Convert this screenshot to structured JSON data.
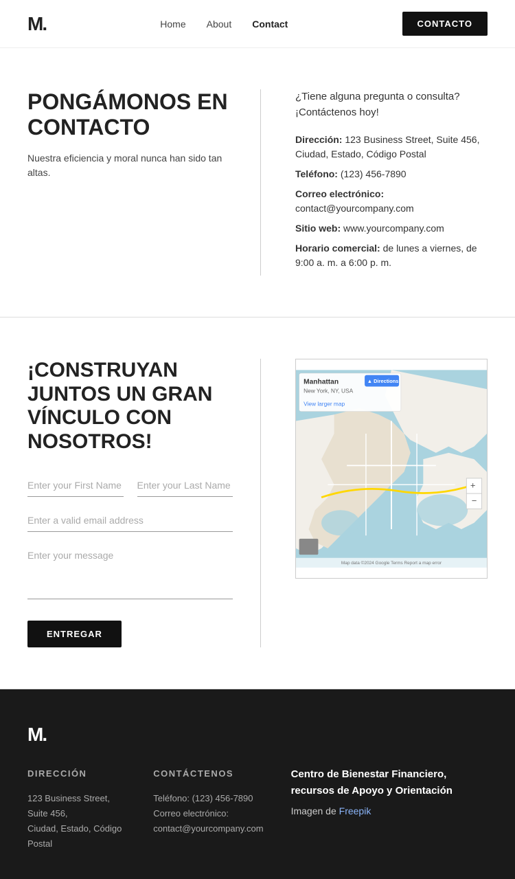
{
  "nav": {
    "logo": "M.",
    "links": [
      {
        "label": "Home",
        "href": "#",
        "active": false
      },
      {
        "label": "About",
        "href": "#",
        "active": false
      },
      {
        "label": "Contact",
        "href": "#",
        "active": true
      }
    ],
    "cta_label": "CONTACTO"
  },
  "section_info": {
    "heading": "PONGÁMONOS EN CONTACTO",
    "subtext": "Nuestra eficiencia y moral nunca han sido tan altas.",
    "intro": "¿Tiene alguna pregunta o consulta? ¡Contáctenos hoy!",
    "details": [
      {
        "label": "Dirección:",
        "value": "123 Business Street, Suite 456, Ciudad, Estado, Código Postal"
      },
      {
        "label": "Teléfono:",
        "value": "(123) 456-7890"
      },
      {
        "label": "Correo electrónico:",
        "value": "contact@yourcompany.com"
      },
      {
        "label": "Sitio web:",
        "value": "www.yourcompany.com"
      },
      {
        "label": "Horario comercial:",
        "value": "de lunes a viernes, de 9:00 a. m. a 6:00 p. m."
      }
    ]
  },
  "section_form": {
    "heading": "¡CONSTRUYAN JUNTOS UN GRAN VÍNCULO CON NOSOTROS!",
    "first_name_placeholder": "Enter your First Name",
    "last_name_placeholder": "Enter your Last Name",
    "email_placeholder": "Enter a valid email address",
    "message_placeholder": "Enter your message",
    "submit_label": "ENTREGAR"
  },
  "map": {
    "label": "Manhattan",
    "sublabel": "New York, NY, USA",
    "directions_label": "Directions",
    "view_larger_label": "View larger map"
  },
  "footer": {
    "logo": "M.",
    "address_heading": "DIRECCIÓN",
    "address_line1": "123 Business Street, Suite 456,",
    "address_line2": "Ciudad, Estado, Código Postal",
    "contact_heading": "CONTÁCTENOS",
    "phone": "Teléfono: (123) 456-7890",
    "email_label": "Correo electrónico:",
    "email_value": "contact@yourcompany.com",
    "right_heading": "Centro de Bienestar Financiero, recursos de Apoyo y Orientación",
    "right_sub": "Imagen de Freepik",
    "freepik_link": "Freepik"
  }
}
